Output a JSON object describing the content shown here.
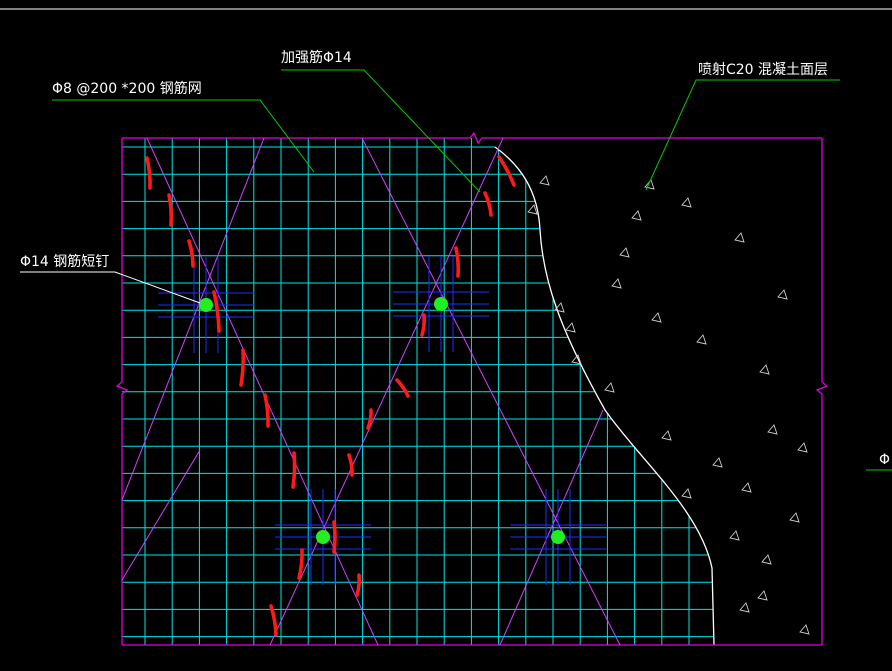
{
  "labels": {
    "mesh": "Φ8 @200 *200 钢筋网",
    "strengthen_bar": "加强筋Φ14",
    "shotcrete": "喷射C20 混凝土面层",
    "pin": "Φ14 钢筋短钉",
    "cut_off_right": "Φ"
  },
  "colors": {
    "background": "#000000",
    "mesh_grid": "#00e5e5",
    "border": "#e000e0",
    "strengthen_bar": "#d040ff",
    "leader_green": "#00cc00",
    "leader_white": "#ffffff",
    "pin_cross": "#2030ff",
    "pin_dot": "#22ee22",
    "marks": "#ff1a1a",
    "concrete_edge": "#ffffff",
    "top_line": "#ffffff"
  },
  "icons": {
    "pin_marker": "green-dot-with-blue-cross",
    "aggregate": "triangle",
    "break_symbol": "zigzag"
  }
}
